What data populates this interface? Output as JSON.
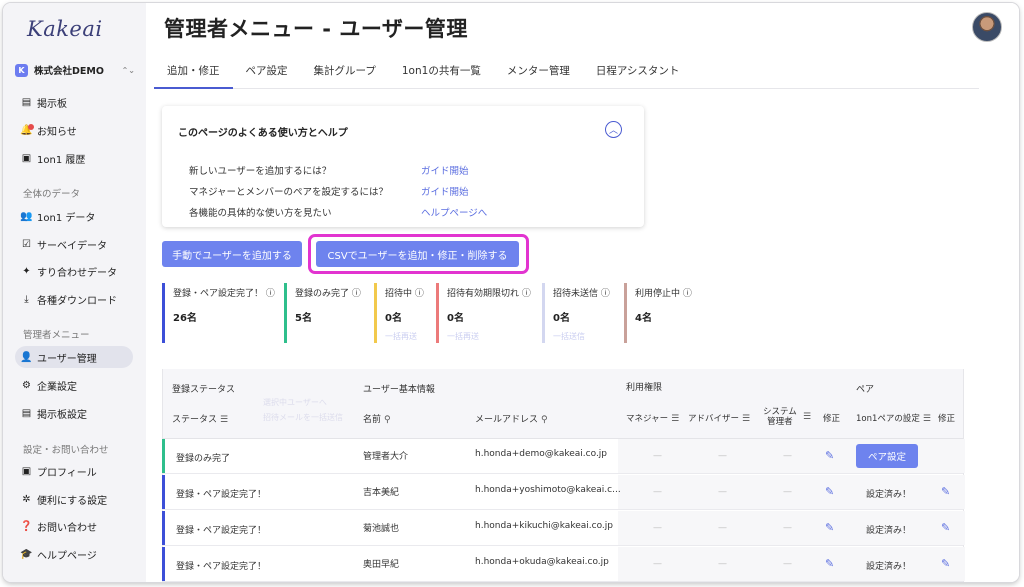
{
  "app": {
    "logo": "Kakeai",
    "company": "株式会社DEMO",
    "company_badge": "K"
  },
  "sidebar": {
    "items_top": [
      {
        "label": "掲示板",
        "icon": "board-icon"
      },
      {
        "label": "お知らせ",
        "icon": "bell-icon"
      },
      {
        "label": "1on1 履歴",
        "icon": "history-icon"
      }
    ],
    "section_data": "全体のデータ",
    "items_data": [
      {
        "label": "1on1 データ",
        "icon": "people-icon"
      },
      {
        "label": "サーベイデータ",
        "icon": "survey-icon"
      },
      {
        "label": "すり合わせデータ",
        "icon": "puzzle-icon"
      },
      {
        "label": "各種ダウンロード",
        "icon": "download-icon"
      }
    ],
    "section_admin": "管理者メニュー",
    "items_admin": [
      {
        "label": "ユーザー管理",
        "icon": "user-admin-icon"
      },
      {
        "label": "企業設定",
        "icon": "company-settings-icon"
      },
      {
        "label": "掲示板設定",
        "icon": "board-settings-icon"
      }
    ],
    "section_settings": "設定・お問い合わせ",
    "items_settings": [
      {
        "label": "プロフィール",
        "icon": "profile-icon"
      },
      {
        "label": "便利にする設定",
        "icon": "gear-icon"
      },
      {
        "label": "お問い合わせ",
        "icon": "question-icon"
      },
      {
        "label": "ヘルプページ",
        "icon": "graduation-icon"
      }
    ]
  },
  "header": {
    "title": "管理者メニュー - ユーザー管理"
  },
  "tabs": [
    "追加・修正",
    "ペア設定",
    "集計グループ",
    "1on1の共有一覧",
    "メンター管理",
    "日程アシスタント"
  ],
  "help": {
    "title": "このページのよくある使い方とヘルプ",
    "rows": [
      {
        "q": "新しいユーザーを追加するには？",
        "link": "ガイド開始"
      },
      {
        "q": "マネジャーとメンバーのペアを設定するには？",
        "link": "ガイド開始"
      },
      {
        "q": "各機能の具体的な使い方を見たい",
        "link": "ヘルプページへ"
      }
    ]
  },
  "buttons": {
    "manual": "手動でユーザーを追加する",
    "csv": "CSVでユーザーを追加・修正・削除する"
  },
  "stats": [
    {
      "label": "登録・ペア設定完了！ ⓘ",
      "value": "26名",
      "sub": "",
      "color": "#3c4fd8"
    },
    {
      "label": "登録のみ完了 ⓘ",
      "value": "5名",
      "sub": "",
      "color": "#2fbf8c"
    },
    {
      "label": "招待中 ⓘ",
      "value": "0名",
      "sub": "一括再送",
      "color": "#f2c94c"
    },
    {
      "label": "招待有効期限切れ ⓘ",
      "value": "0名",
      "sub": "一括再送",
      "color": "#ec7a7a"
    },
    {
      "label": "招待未送信 ⓘ",
      "value": "0名",
      "sub": "一括送信",
      "color": "#d3d7f0"
    },
    {
      "label": "利用停止中 ⓘ",
      "value": "4名",
      "sub": "",
      "color": "#c9a19a"
    }
  ],
  "table": {
    "group_headers": {
      "status": "登録ステータス",
      "basic": "ユーザー基本情報",
      "role": "利用権限",
      "pair": "ペア"
    },
    "faint1": "選択中ユーザーへ",
    "faint2": "招待メールを一括送信",
    "cols": {
      "status": "ステータス",
      "name": "名前",
      "email": "メールアドレス",
      "manager": "マネジャー",
      "advisor": "アドバイザー",
      "sysadmin1": "システム",
      "sysadmin2": "管理者",
      "edit": "修正",
      "pair_setting": "1on1ペアの設定",
      "pair_edit": "修正"
    },
    "rows": [
      {
        "status": "登録のみ完了",
        "name": "管理者大介",
        "email": "h.honda+demo@kakeai.co.jp",
        "pair": "ペア設定",
        "bar": "green"
      },
      {
        "status": "登録・ペア設定完了！",
        "name": "吉本美紀",
        "email": "h.honda+yoshimoto@kakeai.c...",
        "pair": "設定済み！",
        "bar": "blue"
      },
      {
        "status": "登録・ペア設定完了！",
        "name": "菊池誠也",
        "email": "h.honda+kikuchi@kakeai.co.jp",
        "pair": "設定済み！",
        "bar": "blue"
      },
      {
        "status": "登録・ペア設定完了！",
        "name": "奥田早紀",
        "email": "h.honda+okuda@kakeai.co.jp",
        "pair": "設定済み！",
        "bar": "blue"
      }
    ],
    "dash": "—"
  }
}
